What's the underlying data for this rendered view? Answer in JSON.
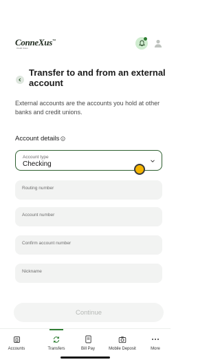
{
  "header": {
    "logo_text": "ConneXus",
    "logo_tm": "™",
    "logo_sub": "Credit Union"
  },
  "page": {
    "title": "Transfer to and from an external account",
    "description": "External accounts are the accounts you hold at other banks and credit unions."
  },
  "account_details": {
    "heading": "Account details",
    "account_type": {
      "label": "Account type",
      "value": "Checking"
    },
    "routing_number": {
      "label": "Routing number"
    },
    "account_number": {
      "label": "Account number"
    },
    "confirm_account_number": {
      "label": "Confirm account number"
    },
    "nickname": {
      "label": "Nickname"
    }
  },
  "continue_label": "Continue",
  "tabs": [
    {
      "label": "Accounts",
      "icon": "accounts-icon"
    },
    {
      "label": "Transfers",
      "icon": "transfers-icon",
      "active": true
    },
    {
      "label": "Bill Pay",
      "icon": "bill-pay-icon"
    },
    {
      "label": "Mobile Deposit",
      "icon": "camera-icon"
    },
    {
      "label": "More",
      "icon": "more-icon"
    }
  ],
  "colors": {
    "accent": "#2e7d32",
    "select_border": "#2c5e2e",
    "bell_bg": "#cfeccf",
    "field_bg": "#f2f3f2"
  }
}
